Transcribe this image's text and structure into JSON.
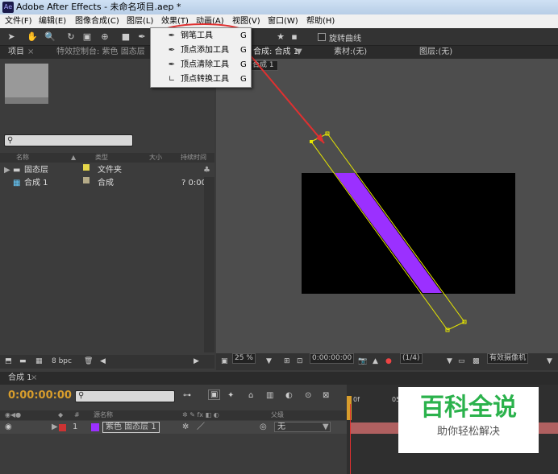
{
  "window": {
    "title": "Adobe After Effects - 未命名项目.aep *"
  },
  "menubar": [
    "文件(F)",
    "编辑(E)",
    "图像合成(C)",
    "图层(L)",
    "效果(T)",
    "动画(A)",
    "视图(V)",
    "窗口(W)",
    "帮助(H)"
  ],
  "toolbar": {
    "option_label": "旋转曲线"
  },
  "pen_menu": {
    "items": [
      {
        "label": "钢笔工具",
        "shortcut": "G"
      },
      {
        "label": "顶点添加工具",
        "shortcut": "G"
      },
      {
        "label": "顶点清除工具",
        "shortcut": "G"
      },
      {
        "label": "顶点转换工具",
        "shortcut": "G"
      }
    ]
  },
  "project": {
    "tab": "项目",
    "tab2": "特效控制台: 紫色 固态层",
    "columns": [
      "名称",
      "类型",
      "大小",
      "持续时间"
    ],
    "rows": [
      {
        "name": "固态层",
        "type": "文件夹",
        "duration": ""
      },
      {
        "name": "合成 1",
        "type": "合成",
        "duration": "? 0:00"
      }
    ],
    "bpc": "8 bpc"
  },
  "viewer": {
    "tab": "合成: 合成 1",
    "footage": "素材:(无)",
    "layer": "图层:(无)",
    "breadcrumb": "合成 1",
    "zoom": "25 %",
    "timecode": "0:00:00:00",
    "resolution": "(1/4)",
    "camera": "有效摄像机"
  },
  "timeline": {
    "tab": "合成 1",
    "timecode": "0:00:00:00",
    "columns": [
      "#",
      "源名称",
      "父级"
    ],
    "layer": {
      "index": "1",
      "name": "紫色 固态层 1",
      "parent": "无"
    },
    "ruler": [
      "0f",
      "05"
    ]
  },
  "watermark": {
    "line1": "百科全说",
    "line2": "助你轻松解决"
  },
  "colors": {
    "accent_timecode": "#d89d2c",
    "layer_color": "#9b30ff",
    "annotation": "#e03030",
    "path": "#e6e600"
  }
}
